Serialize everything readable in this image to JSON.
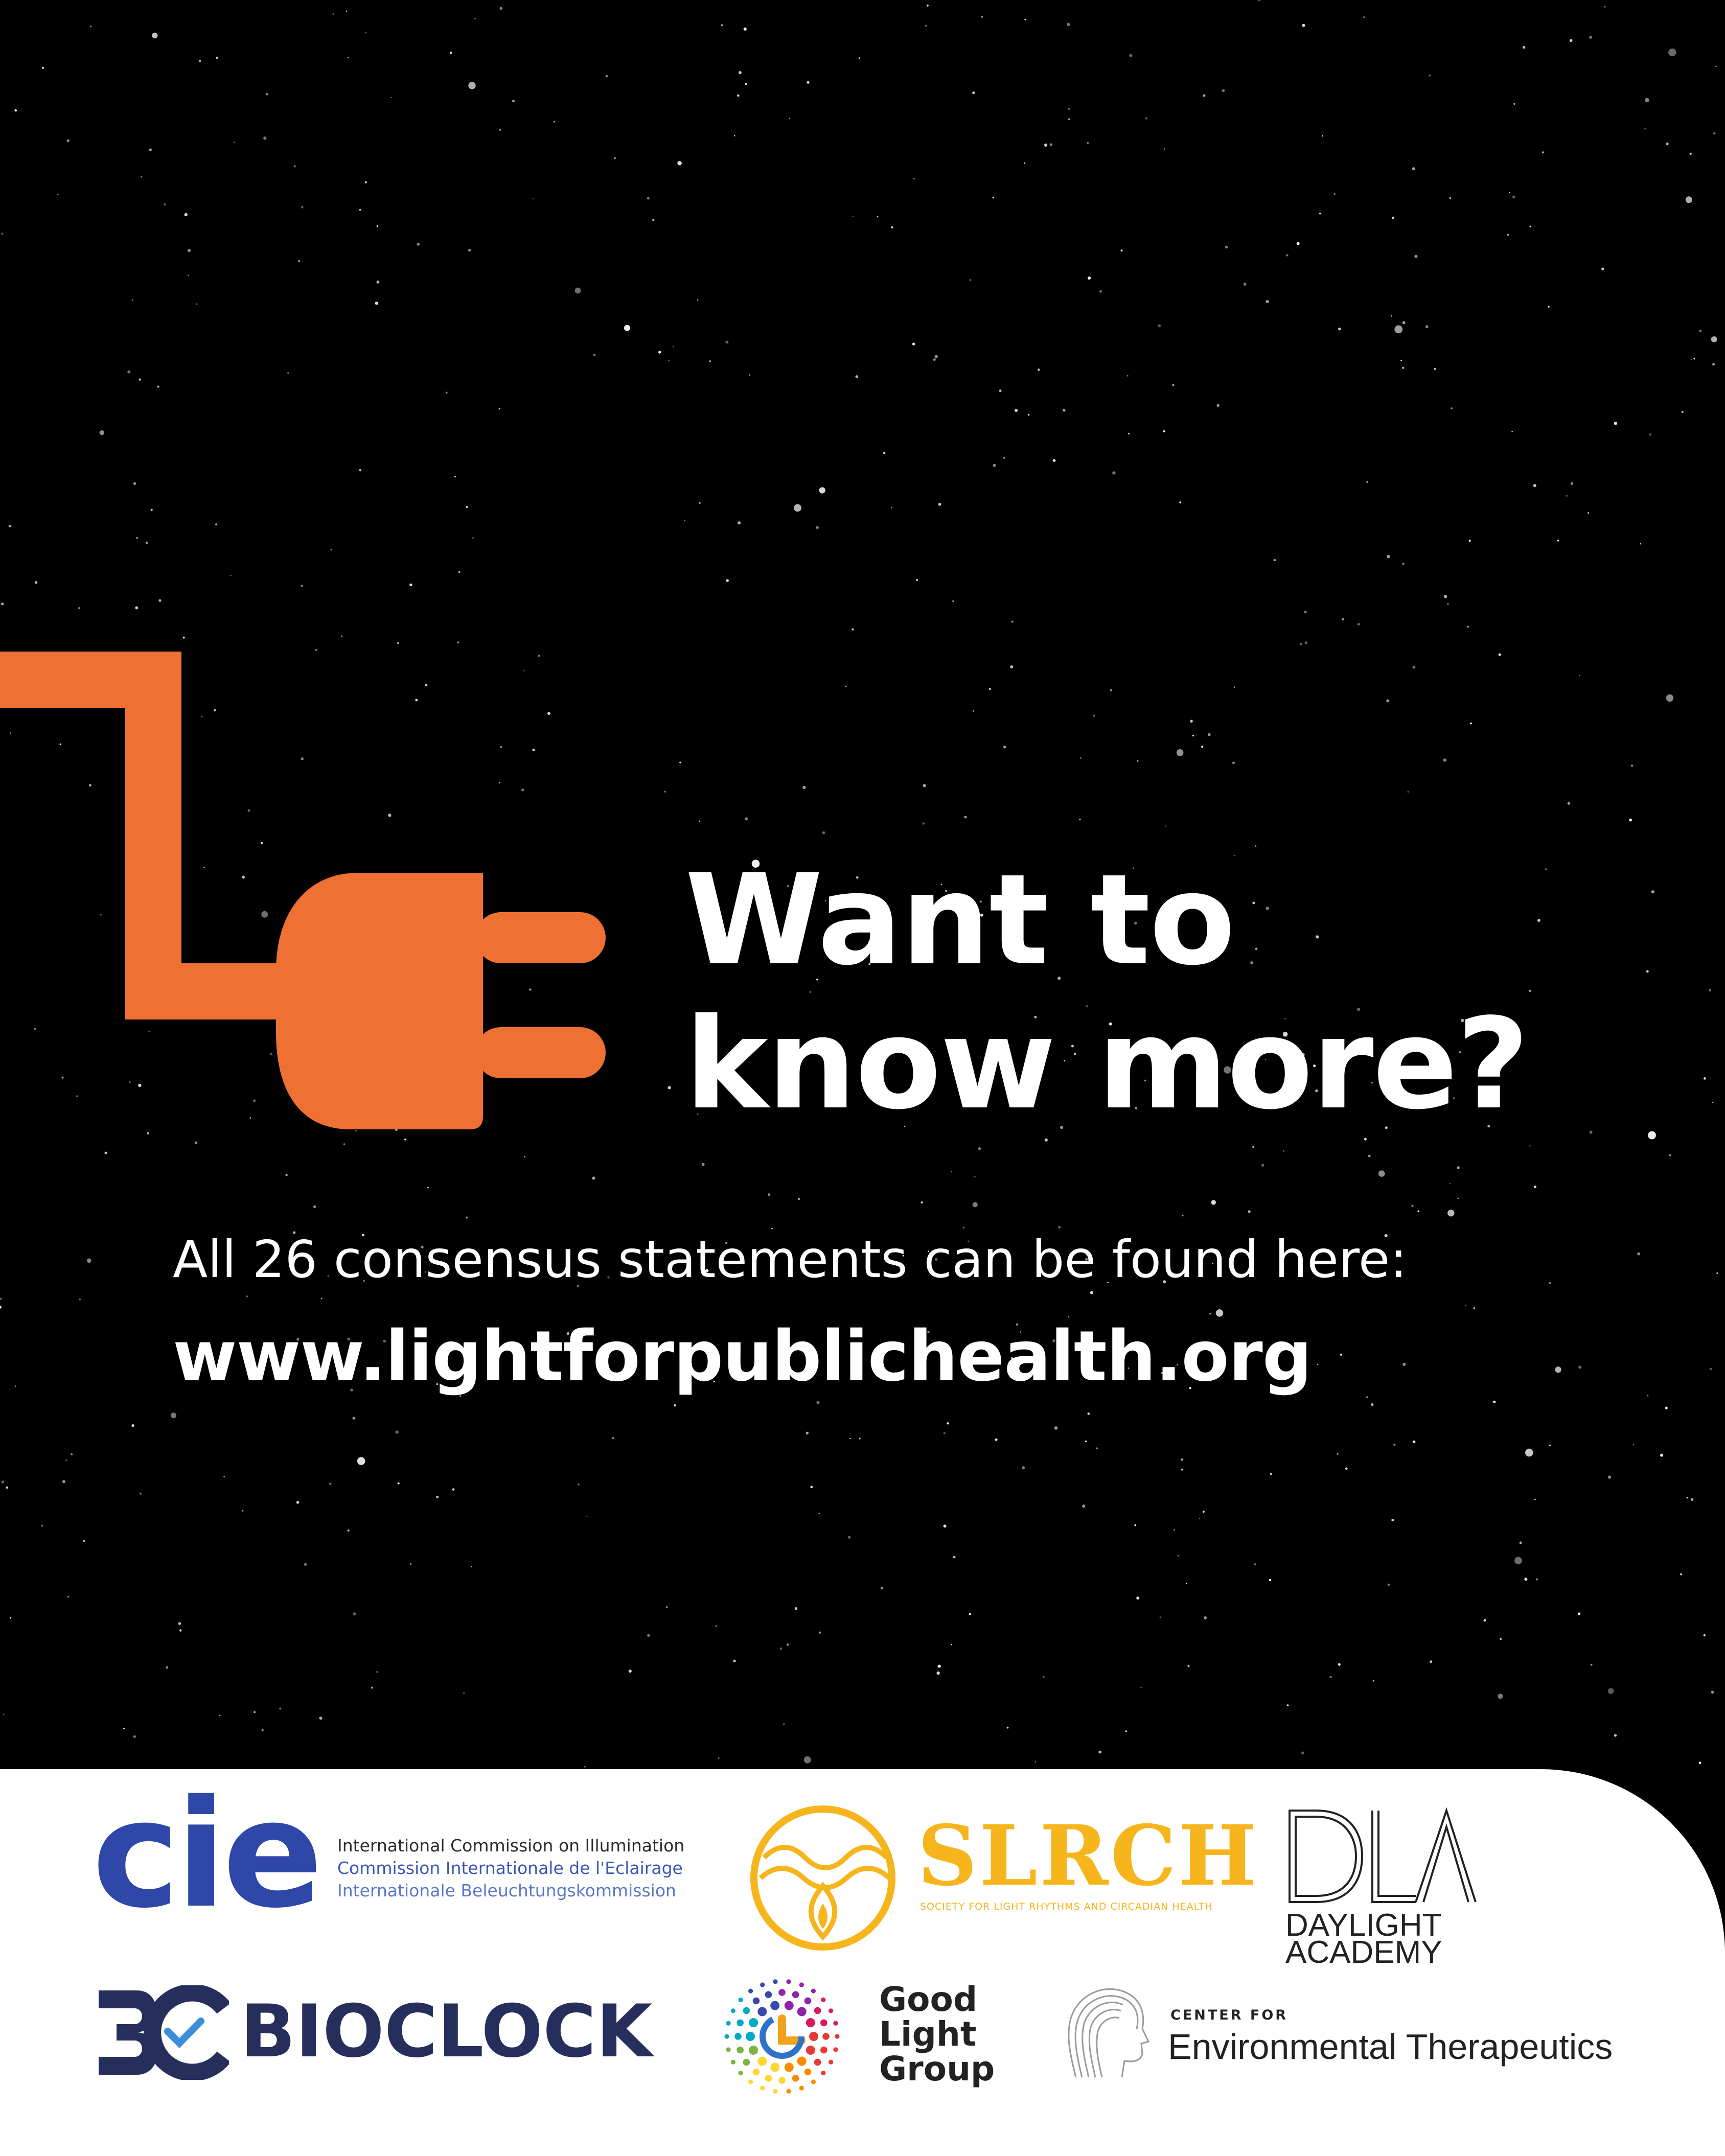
{
  "colors": {
    "background": "#000000",
    "plug": "#ee7032",
    "text": "#ffffff",
    "panel": "#ffffff",
    "cie_blue": "#2f47a8",
    "slrch_gold": "#f6b51d",
    "bioclock_navy": "#262f5c"
  },
  "icons": {
    "plug": "electrical-plug-icon",
    "stars": "starfield"
  },
  "headline": {
    "line1": "Want to",
    "line2": "know more?"
  },
  "statement": "All 26 consensus statements can be found here:",
  "url": "www.lightforpublichealth.org",
  "logos": {
    "cie": {
      "wordmark": "cie",
      "line1": "International Commission on Illumination",
      "line2": "Commission Internationale de l'Eclairage",
      "line3": "Internationale Beleuchtungskommission"
    },
    "slrch": {
      "wordmark": "SLRCH",
      "subtitle": "SOCIETY FOR LIGHT RHYTHMS AND CIRCADIAN HEALTH"
    },
    "dla": {
      "wordmark": "DLA",
      "line1": "DAYLIGHT",
      "line2": "ACADEMY"
    },
    "bioclock": {
      "wordmark": "BIOCLOCK"
    },
    "glg": {
      "line1": "Good",
      "line2": "Light",
      "line3": "Group"
    },
    "cet": {
      "top": "CENTER FOR",
      "main": "Environmental Therapeutics"
    }
  }
}
